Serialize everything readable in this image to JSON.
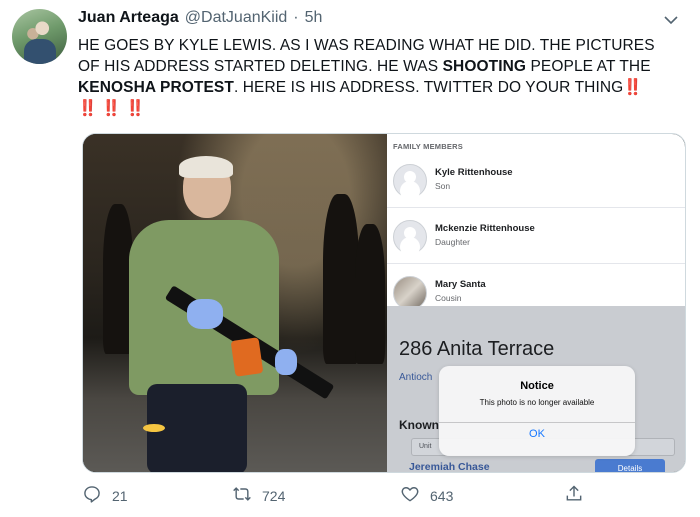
{
  "tweet": {
    "author": {
      "display_name": "Juan Arteaga",
      "handle": "@DatJuanKiid",
      "separator": "·",
      "time": "5h"
    },
    "text": {
      "line1": "HE GOES BY KYLE LEWIS. AS I WAS READING WHAT HE DID. THE PICTURES",
      "line2_a": "OF HIS ADDRESS STARTED DELETING. HE WAS ",
      "line2_bold": "SHOOTING",
      "line2_b": " PEOPLE AT THE",
      "line3_bold": "KENOSHA PROTEST",
      "line3_a": ". HERE IS HIS ADDRESS. TWITTER DO YOUR THING",
      "line3_bang": "‼️",
      "line4": "‼️ ‼️ ‼️"
    },
    "media": {
      "screenshot": {
        "section_title": "FAMILY MEMBERS",
        "members": [
          {
            "name": "Kyle Rittenhouse",
            "relation": "Son"
          },
          {
            "name": "Mckenzie Rittenhouse",
            "relation": "Daughter"
          },
          {
            "name": "Mary Santa",
            "relation": "Cousin"
          }
        ],
        "address": "286 Anita Terrace",
        "city": "Antioch",
        "known_label": "Known",
        "unit_label": "Unit",
        "resident": "Jeremiah Chase",
        "details_label": "Details",
        "dialog": {
          "title": "Notice",
          "message": "This photo is no longer available",
          "ok_label": "OK"
        }
      }
    },
    "actions": {
      "replies": "21",
      "retweets": "724",
      "likes": "643"
    },
    "icons": {
      "reply": "reply-icon",
      "retweet": "retweet-icon",
      "like": "heart-icon",
      "share": "share-icon",
      "more": "chevron-down-icon"
    },
    "colors": {
      "text": "#0f1419",
      "secondary": "#536471",
      "emphasis_red": "#e0245e",
      "dialog_link": "#1677ff"
    }
  }
}
